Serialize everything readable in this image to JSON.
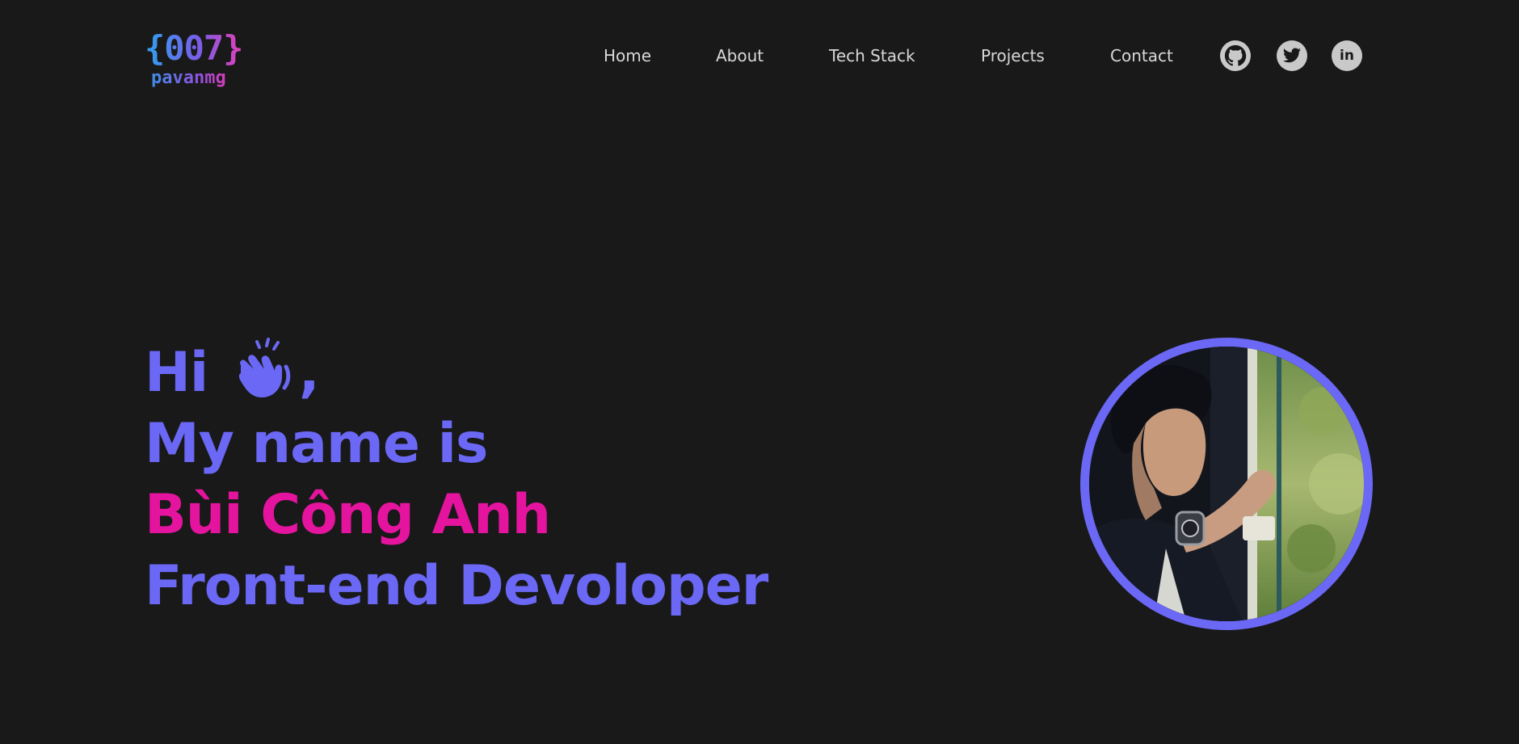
{
  "logo": {
    "code": "{007}",
    "name": "pavanmg"
  },
  "nav": {
    "items": [
      {
        "label": "Home"
      },
      {
        "label": "About"
      },
      {
        "label": "Tech Stack"
      },
      {
        "label": "Projects"
      },
      {
        "label": "Contact"
      }
    ]
  },
  "social": {
    "icons": [
      "github-icon",
      "twitter-icon",
      "linkedin-icon"
    ],
    "linkedin_text": "in"
  },
  "hero": {
    "greeting": "Hi",
    "greeting_suffix": ",",
    "intro": "My name is",
    "name": "Bùi Công Anh",
    "role": "Front-end Devoloper",
    "wave_icon": "waving-hand-icon"
  },
  "colors": {
    "background": "#191919",
    "accent_blue": "#6a68f5",
    "accent_pink": "#e5149f",
    "nav_text": "#d8d8d8",
    "social_icon_bg": "#c9c9c9"
  }
}
